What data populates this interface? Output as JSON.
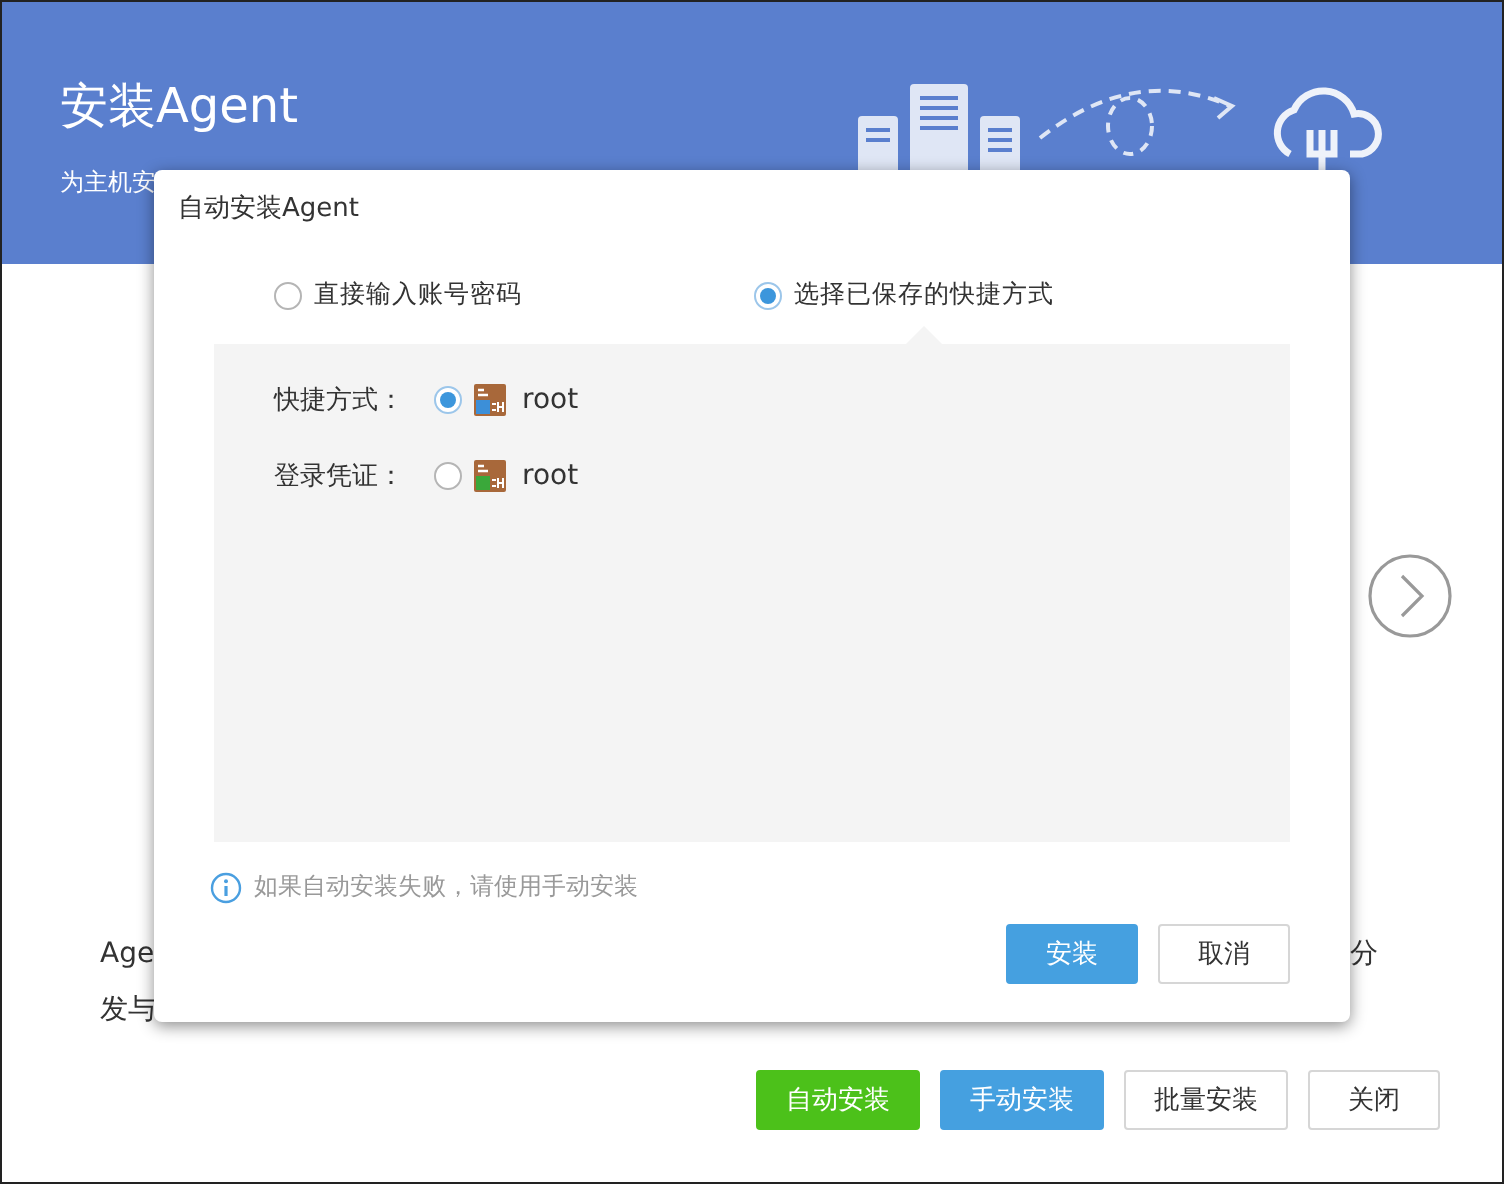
{
  "page": {
    "title": "安装Agent",
    "subtitle": "为主机安",
    "description": [
      {
        "text": "Age"
      },
      {
        "text": "分"
      },
      {
        "text": "发与"
      }
    ],
    "buttons": [
      {
        "label": "自动安装",
        "kind": "success"
      },
      {
        "label": "手动安装",
        "kind": "primary"
      },
      {
        "label": "批量安装",
        "kind": "default"
      },
      {
        "label": "关闭",
        "kind": "default"
      }
    ]
  },
  "dialog": {
    "title": "自动安装Agent",
    "modes": [
      {
        "label": "直接输入账号密码",
        "selected": false
      },
      {
        "label": "选择已保存的快捷方式",
        "selected": true
      }
    ],
    "fields": [
      {
        "label": "快捷方式：",
        "selected": true,
        "value": "root",
        "color": "#3c8fd8"
      },
      {
        "label": "登录凭证：",
        "selected": false,
        "value": "root",
        "color": "#3aa83a"
      }
    ],
    "hint": "如果自动安装失败，请使用手动安装",
    "buttons": [
      {
        "label": "安装",
        "kind": "primary"
      },
      {
        "label": "取消",
        "kind": "default"
      }
    ]
  }
}
